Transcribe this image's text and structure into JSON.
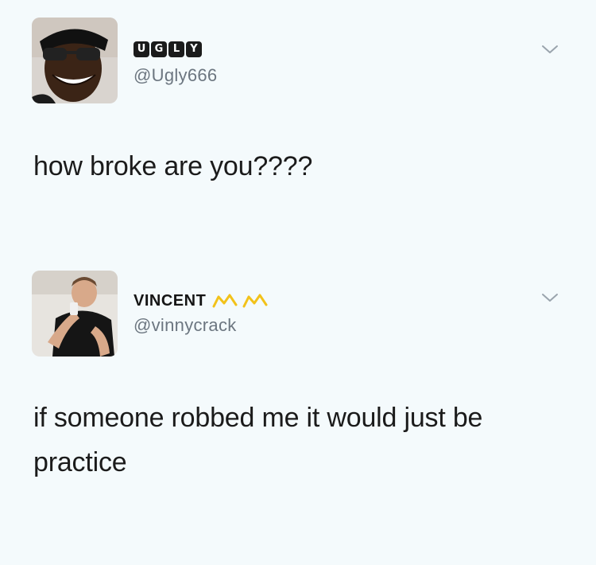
{
  "tweets": [
    {
      "display_name": "UGLY",
      "display_name_letters": [
        "U",
        "G",
        "L",
        "Y"
      ],
      "handle": "@Ugly666",
      "text": "how broke are you????",
      "avatar_icon": "profile-photo-smiling-man-sunglasses"
    },
    {
      "display_name": "VINCENT",
      "name_emoji": "crown-icon",
      "handle": "@vinnycrack",
      "text": "if someone robbed me it would just be practice",
      "avatar_icon": "profile-photo-man-holding-phone"
    }
  ],
  "colors": {
    "background": "#f4fafc",
    "text": "#1b1b1b",
    "handle": "#6c7680",
    "chevron": "#9aa4ad",
    "emoji": "#f2c21a"
  }
}
